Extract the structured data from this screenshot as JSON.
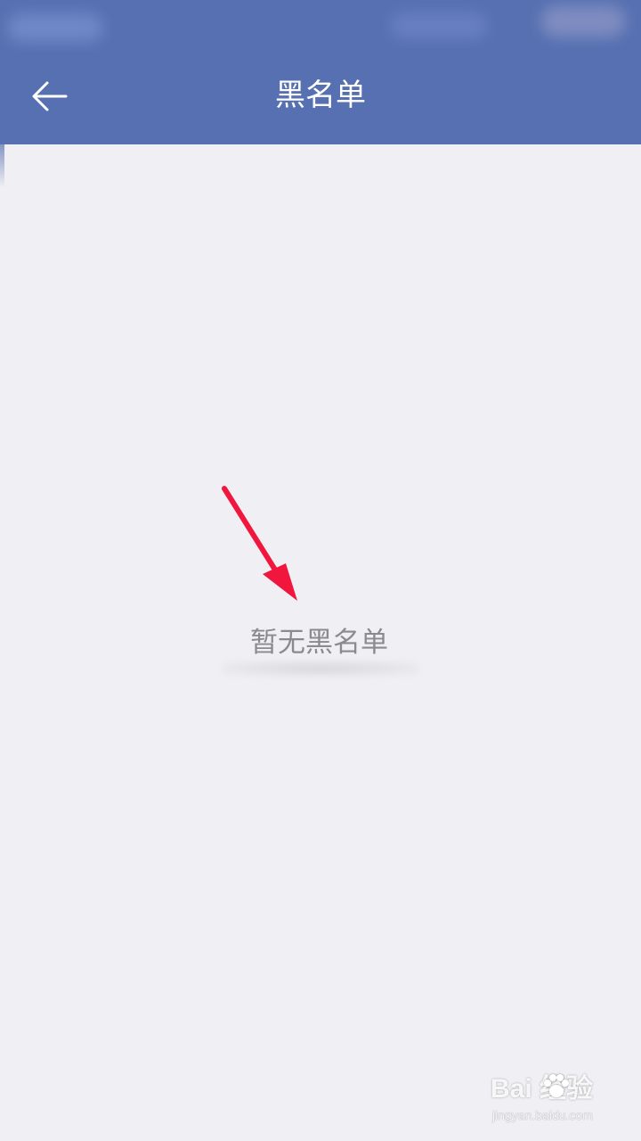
{
  "header": {
    "back_icon": "arrow-left-icon",
    "title": "黑名单"
  },
  "main": {
    "empty_message": "暂无黑名单"
  },
  "annotation": {
    "arrow_icon": "red-arrow-annotation",
    "color": "#f0163d"
  },
  "watermark": {
    "brand": "Bai  经验",
    "url": "jingyan.baidu.com"
  },
  "colors": {
    "header_background": "#5670b1",
    "page_background": "#efeff4",
    "empty_text": "#8a8a8f"
  }
}
